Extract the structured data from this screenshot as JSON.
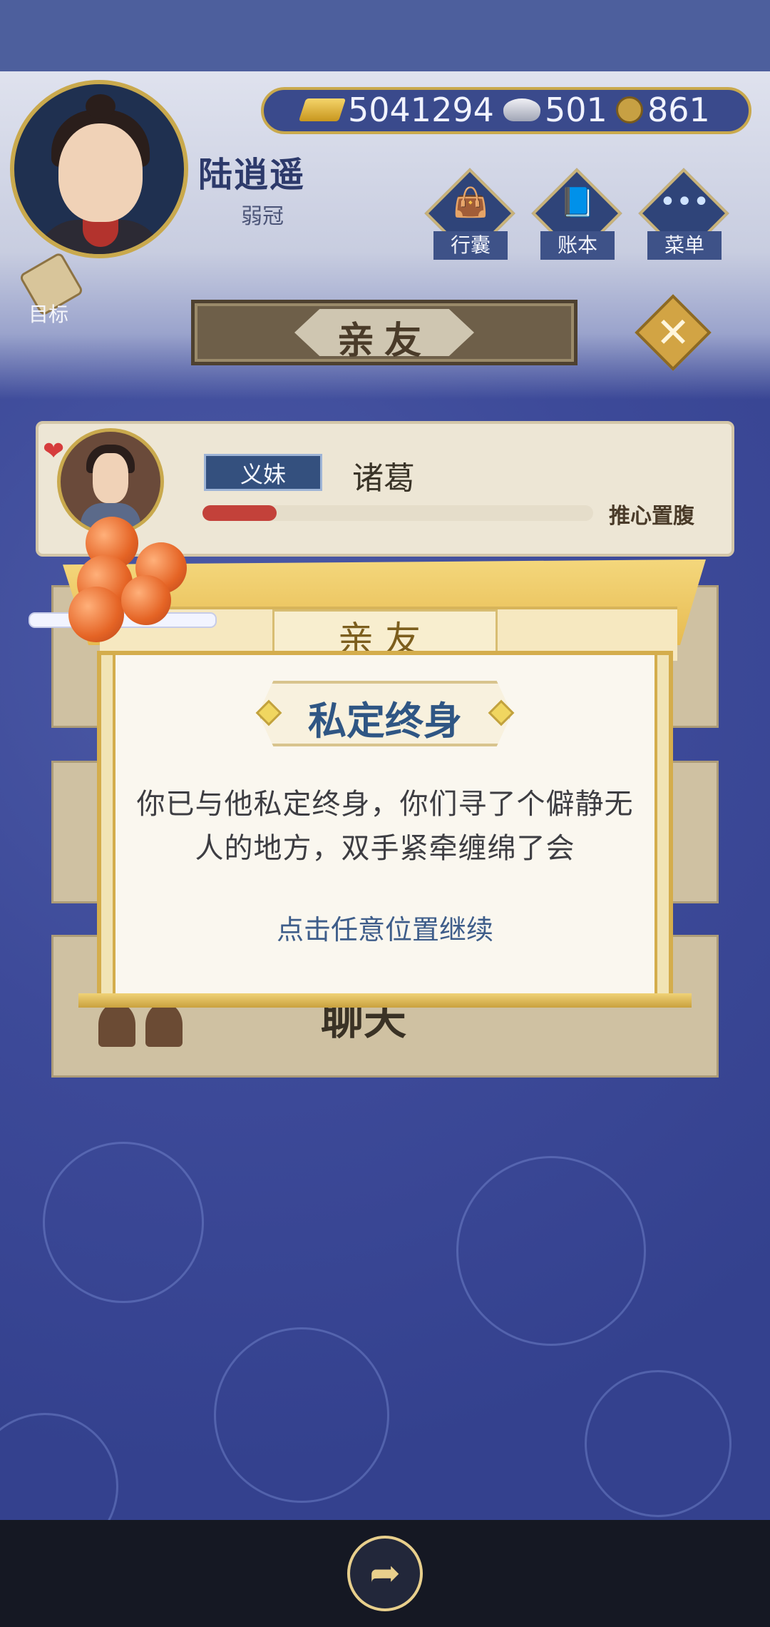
{
  "header": {
    "player_name": "陆逍遥",
    "player_rank": "弱冠",
    "resources": {
      "gold": "5041294",
      "silver": "501",
      "coin": "861"
    },
    "menu": [
      {
        "label": "行囊",
        "icon": "bag-icon"
      },
      {
        "label": "账本",
        "icon": "ledger-icon"
      },
      {
        "label": "菜单",
        "icon": "more-icon"
      }
    ],
    "goal_label": "目标"
  },
  "panel": {
    "title": "亲友",
    "close_icon": "close-icon"
  },
  "friend": {
    "relation": "义妹",
    "name": "诸葛",
    "bond_status": "推心置腹",
    "bond_level": 0.19
  },
  "background_list": {
    "visible_label": "聊天"
  },
  "modal": {
    "header_title": "亲友",
    "event_title": "私定终身",
    "event_text": "你已与他私定终身，你们寻了个僻静无人的地方，双手紧牵缠绵了会",
    "continue_hint": "点击任意位置继续"
  },
  "bottom": {
    "share_icon": "share-icon"
  }
}
